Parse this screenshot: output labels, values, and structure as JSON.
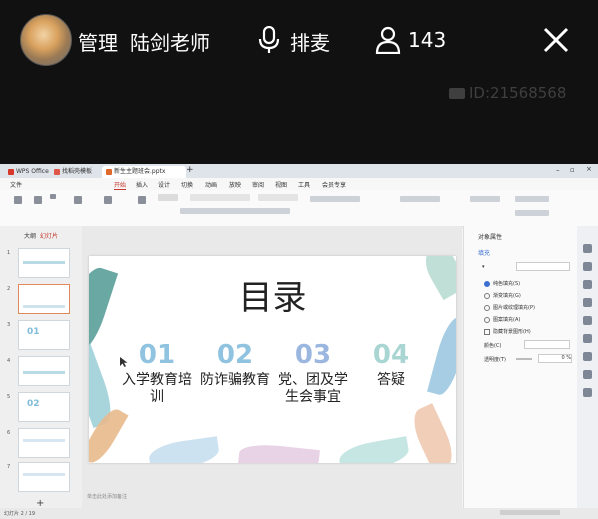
{
  "stream": {
    "role_tag": "管理",
    "host_name": "陆剑老师",
    "mic_label": "排麦",
    "viewer_count": "143",
    "watermark_id": "ID:21568568"
  },
  "wps": {
    "tabs": [
      "WPS Office",
      "找稻壳模板",
      "新生主题班会.pptx"
    ],
    "menus": [
      "文件",
      "开始",
      "插入",
      "设计",
      "切换",
      "动画",
      "放映",
      "审阅",
      "视图",
      "工具",
      "会员专享"
    ],
    "left_tabs": [
      "大纲",
      "幻灯片"
    ],
    "notes_placeholder": "单击此处添加备注",
    "right_panel_title": "对象属性",
    "right_panel_tab": "填充",
    "fill_options": [
      "纯色填充(S)",
      "渐变填充(G)",
      "图片或纹理填充(P)",
      "图案填充(A)",
      "隐藏背景图形(H)"
    ],
    "color_label": "颜色(C)",
    "transparency_label": "透明度(T)",
    "transparency_value": "0",
    "transparency_unit": "%",
    "status_left": "幻灯片 2 / 19"
  },
  "slide": {
    "title": "目录",
    "items": [
      {
        "num": "01",
        "caption": "入学教育培训",
        "color": "#8fc3e0"
      },
      {
        "num": "02",
        "caption": "防诈骗教育",
        "color": "#8fc3e0"
      },
      {
        "num": "03",
        "caption": "党、团及学生会事宜",
        "color": "#9bb7e0"
      },
      {
        "num": "04",
        "caption": "答疑",
        "color": "#a9d6d2"
      }
    ]
  },
  "colors": {
    "accent": "#c4372a",
    "topbar_bg": "#111111"
  }
}
